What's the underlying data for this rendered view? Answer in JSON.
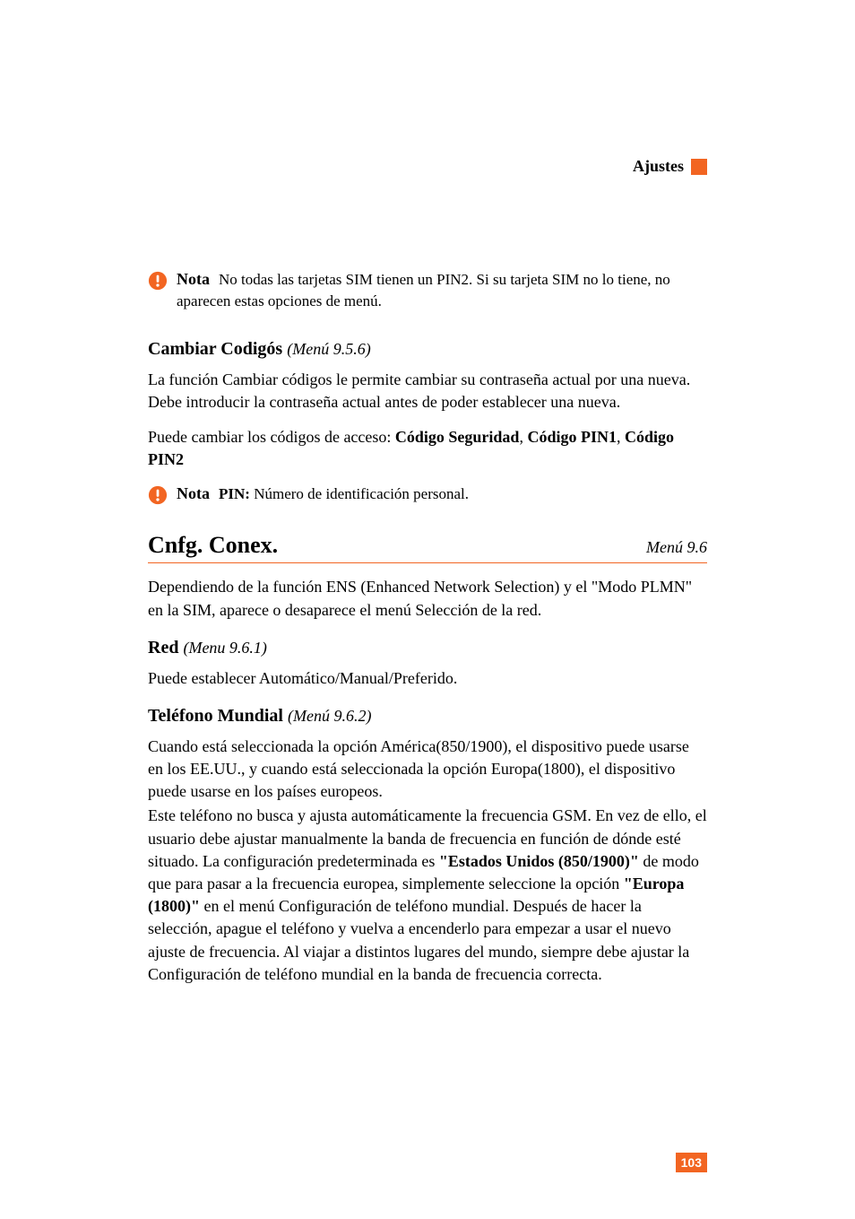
{
  "header": {
    "title": "Ajustes"
  },
  "note1": {
    "label": "Nota",
    "text": "No todas las tarjetas SIM tienen un PIN2. Si su tarjeta SIM no lo tiene, no aparecen estas opciones de menú."
  },
  "section1": {
    "heading": "Cambiar Codigós",
    "menu": "(Menú 9.5.6)",
    "para1": "La función Cambiar códigos le permite cambiar su contraseña actual por una nueva. Debe introducir la contraseña actual antes de poder establecer una nueva.",
    "para2_prefix": "Puede cambiar los códigos de acceso: ",
    "para2_b1": "Código Seguridad",
    "para2_sep1": ", ",
    "para2_b2": "Código PIN1",
    "para2_sep2": ", ",
    "para2_b3": "Código PIN2"
  },
  "note2": {
    "label": "Nota",
    "bold": "PIN:",
    "text": " Número de identificación personal."
  },
  "section2": {
    "heading": "Cnfg. Conex.",
    "menu": "Menú 9.6",
    "para1": "Dependiendo de la función ENS (Enhanced Network Selection) y el \"Modo PLMN\" en la SIM, aparece o desaparece el menú Selección de la red."
  },
  "section3": {
    "heading": "Red",
    "menu": "(Menu 9.6.1)",
    "para1": "Puede establecer Automático/Manual/Preferido."
  },
  "section4": {
    "heading": "Teléfono Mundial",
    "menu": "(Menú 9.6.2)",
    "para1_a": "Cuando está seleccionada la opción América(850/1900), el dispositivo puede usarse en los EE.UU., y cuando está seleccionada la opción Europa(1800), el dispositivo puede usarse en los países europeos.",
    "para2_a": "Este teléfono no busca y ajusta automáticamente la frecuencia GSM. En vez de ello, el usuario debe ajustar manualmente la banda de frecuencia en función de dónde esté situado. La configuración predeterminada es ",
    "para2_b1": "\"Estados Unidos (850/1900)\"",
    "para2_b": " de modo que para pasar a la frecuencia europea, simplemente seleccione la opción ",
    "para2_b2": "\"Europa (1800)\"",
    "para2_c": " en el menú Configuración de teléfono mundial. Después de hacer la selección, apague el teléfono y vuelva a encenderlo para empezar a usar el nuevo ajuste de frecuencia. Al viajar a distintos lugares del mundo, siempre debe ajustar la Configuración de teléfono mundial en la banda de frecuencia correcta."
  },
  "page_number": "103"
}
